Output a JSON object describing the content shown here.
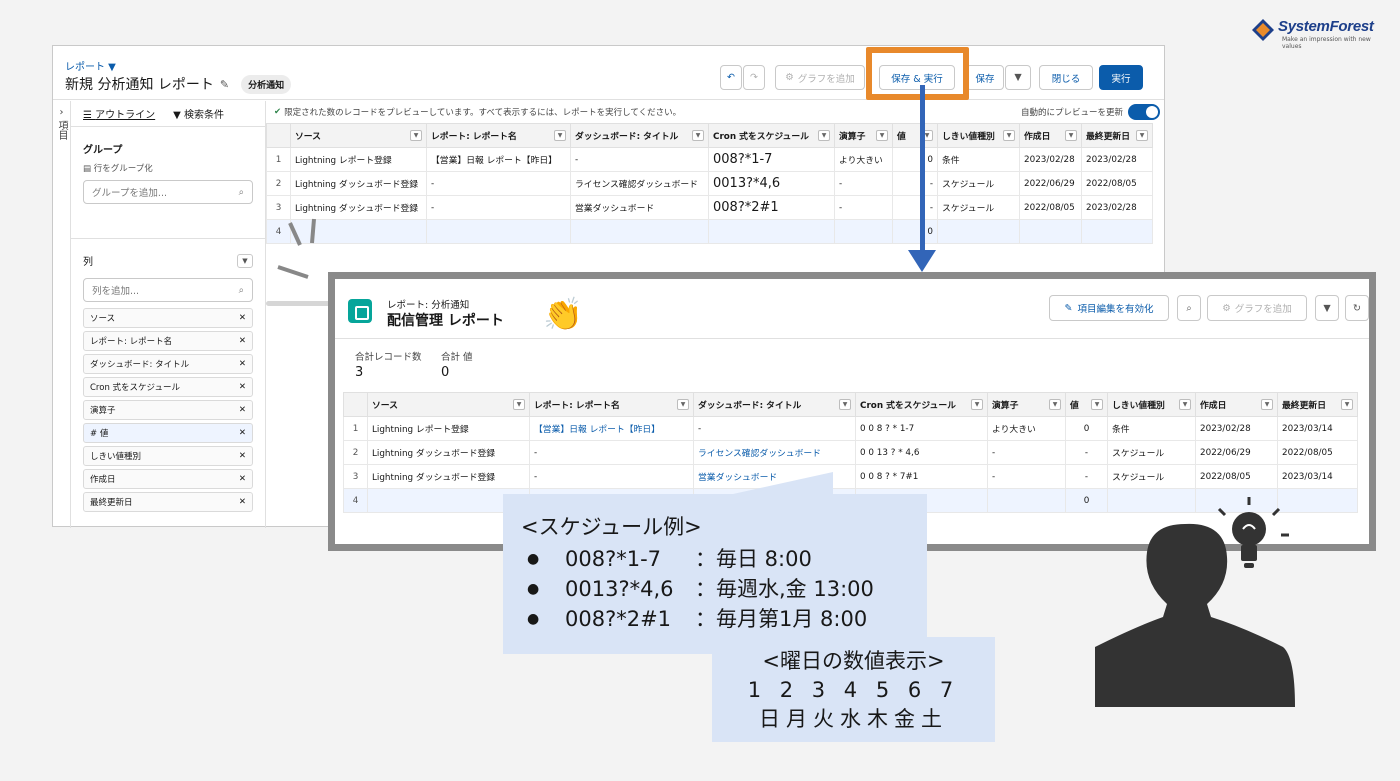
{
  "brand": {
    "name": "SystemForest",
    "tagline": "Make an impression with new values"
  },
  "builder": {
    "breadcrumb": "レポート ▼",
    "title": "新規 分析通知 レポート",
    "pill": "分析通知",
    "buttons": {
      "chart": "グラフを追加",
      "save_run": "保存 & 実行",
      "save": "保存",
      "close": "閉じる",
      "run": "実行"
    },
    "side_label": "項目",
    "tabs": {
      "outline": "アウトライン",
      "filters": "検索条件"
    },
    "group_title": "グループ",
    "group_rows": "行をグループ化",
    "group_placeholder": "グループを追加...",
    "columns_title": "列",
    "columns_placeholder": "列を追加...",
    "column_chips": [
      "ソース",
      "レポート: レポート名",
      "ダッシュボード: タイトル",
      "Cron 式をスケジュール",
      "演算子",
      "# 値",
      "しきい値種別",
      "作成日",
      "最終更新日"
    ],
    "info": "限定された数のレコードをプレビューしています。すべて表示するには、レポートを実行してください。",
    "autopreview": "自動的にプレビューを更新",
    "headers": [
      "ソース",
      "レポート: レポート名",
      "ダッシュボード: タイトル",
      "Cron 式をスケジュール",
      "演算子",
      "値",
      "しきい値種別",
      "作成日",
      "最終更新日"
    ],
    "rows": [
      [
        "1",
        "Lightning レポート登録",
        "【営業】日報 レポート【昨日】",
        "-",
        "008?*1-7",
        "より大きい",
        "0",
        "条件",
        "2023/02/28",
        "2023/02/28"
      ],
      [
        "2",
        "Lightning ダッシュボード登録",
        "-",
        "ライセンス確認ダッシュボード",
        "0013?*4,6",
        "-",
        "-",
        "スケジュール",
        "2022/06/29",
        "2022/08/05"
      ],
      [
        "3",
        "Lightning ダッシュボード登録",
        "-",
        "営業ダッシュボード",
        "008?*2#1",
        "-",
        "-",
        "スケジュール",
        "2022/08/05",
        "2023/02/28"
      ],
      [
        "4",
        "",
        "",
        "",
        "",
        "",
        "0",
        "",
        "",
        ""
      ]
    ]
  },
  "result": {
    "subtitle": "レポート: 分析通知",
    "title": "配信管理 レポート",
    "buttons": {
      "edit": "項目編集を有効化",
      "chart": "グラフを追加"
    },
    "kpi": [
      {
        "label": "合計レコード数",
        "value": "3"
      },
      {
        "label": "合計 値",
        "value": "0"
      }
    ],
    "headers": [
      "ソース",
      "レポート: レポート名",
      "ダッシュボード: タイトル",
      "Cron 式をスケジュール",
      "演算子",
      "値",
      "しきい値種別",
      "作成日",
      "最終更新日"
    ],
    "rows": [
      [
        "1",
        "Lightning レポート登録",
        "【営業】日報 レポート【昨日】",
        "-",
        "0 0 8 ? * 1-7",
        "より大きい",
        "0",
        "条件",
        "2023/02/28",
        "2023/03/14"
      ],
      [
        "2",
        "Lightning ダッシュボード登録",
        "-",
        "ライセンス確認ダッシュボード",
        "0 0 13 ? * 4,6",
        "-",
        "-",
        "スケジュール",
        "2022/06/29",
        "2022/08/05"
      ],
      [
        "3",
        "Lightning ダッシュボード登録",
        "-",
        "営業ダッシュボード",
        "0 0 8 ? * 7#1",
        "-",
        "-",
        "スケジュール",
        "2022/08/05",
        "2023/03/14"
      ],
      [
        "4",
        "",
        "",
        "",
        "",
        "",
        "0",
        "",
        "",
        ""
      ]
    ]
  },
  "callout_schedule": {
    "title": "<スケジュール例>",
    "items": [
      {
        "cron": "008?*1-7",
        "desc": "：毎日 8:00"
      },
      {
        "cron": "0013?*4,6",
        "desc": "：毎週水,金 13:00"
      },
      {
        "cron": "008?*2#1",
        "desc": "：毎月第1月 8:00"
      }
    ]
  },
  "callout_days": {
    "title": "<曜日の数値表示>",
    "numbers": "1 2 3 4 5 6 7",
    "days": "日月火水木金土"
  },
  "colors": {
    "accent": "#0b5cab",
    "highlight": "#e8892b",
    "arrow": "#3265b8",
    "callout": "#d9e4f6"
  }
}
